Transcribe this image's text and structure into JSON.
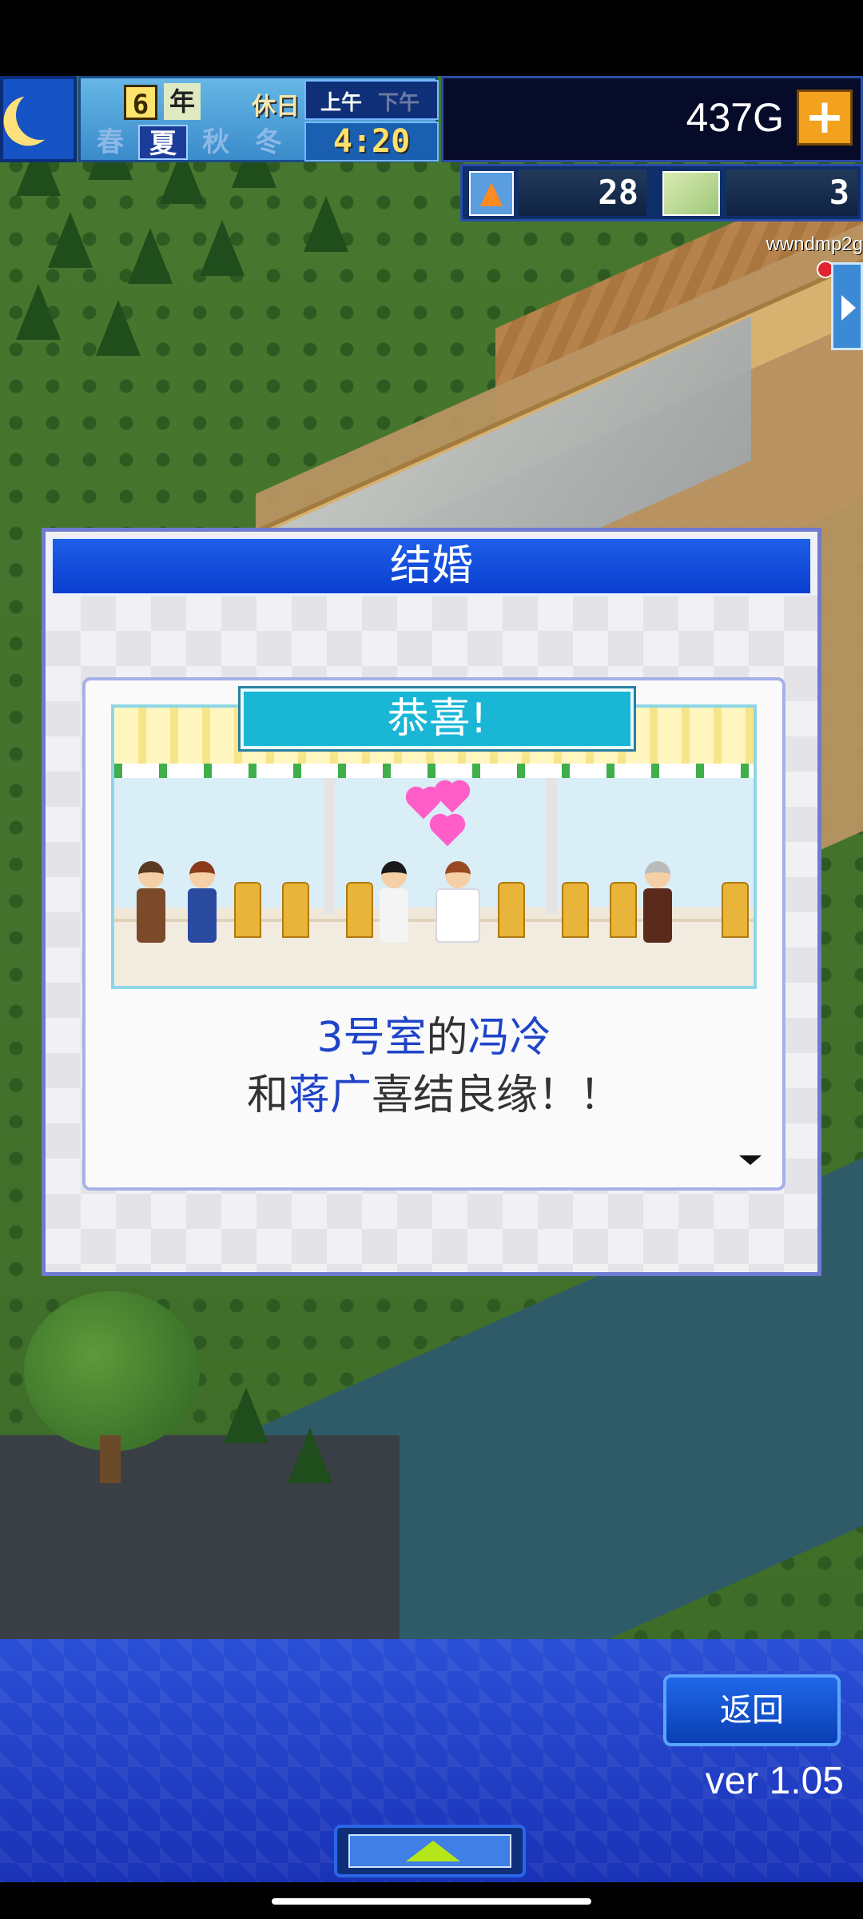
{
  "hud": {
    "year_number": "6",
    "year_label": "年",
    "holiday_label": "休日",
    "am_label": "上午",
    "pm_label": "下午",
    "seasons": [
      "春",
      "夏",
      "秋",
      "冬"
    ],
    "active_season": "夏",
    "time": "4:20",
    "money": "437G",
    "plus_label": "+",
    "research_points": "28",
    "tickets": "3",
    "username": "wwndmp2g"
  },
  "dialog": {
    "title": "结婚",
    "banner": "恭喜!",
    "room": "3号室",
    "de": "的",
    "name1": "冯冷",
    "he": "和",
    "name2": "蒋广",
    "suffix": "喜结良缘！！"
  },
  "bottom": {
    "back_label": "返回",
    "version": "ver 1.05"
  }
}
